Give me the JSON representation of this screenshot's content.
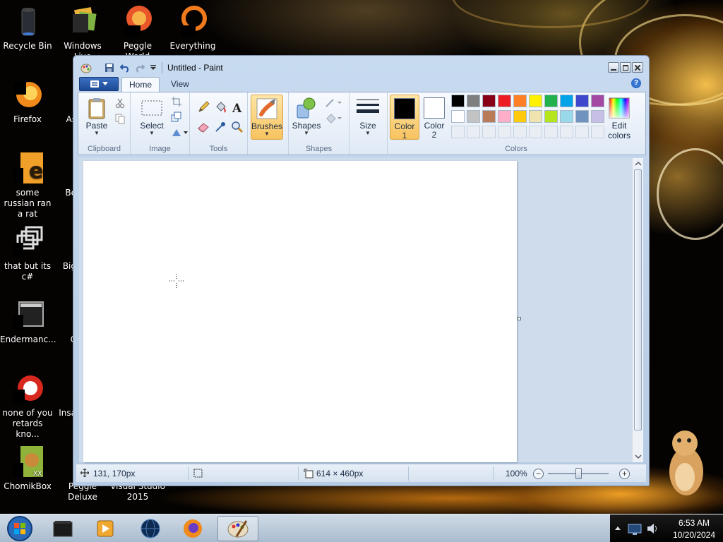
{
  "desktop": {
    "icons": [
      {
        "label": "Recycle Bin"
      },
      {
        "label": "Windows Live"
      },
      {
        "label": "Peggle World"
      },
      {
        "label": "Everything"
      },
      {
        "label": "Firefox"
      },
      {
        "label": "some russian ran a rat"
      },
      {
        "label": "that but its c#"
      },
      {
        "label": "Endermanc..."
      },
      {
        "label": "none of you retards kno..."
      },
      {
        "label": "ChomikBox"
      },
      {
        "label": "Peggle Deluxe"
      },
      {
        "label": "Visual Studio 2015"
      }
    ],
    "partial_labels": [
      "As",
      "Be",
      "Big",
      "C",
      "Insa"
    ]
  },
  "paint": {
    "title": "Untitled - Paint",
    "tabs": [
      "Home",
      "View"
    ],
    "help_icon": "?",
    "groups": {
      "clipboard": {
        "label": "Clipboard",
        "paste": "Paste"
      },
      "image": {
        "label": "Image",
        "select": "Select"
      },
      "tools": {
        "label": "Tools"
      },
      "brushes": {
        "label": "Brushes"
      },
      "shapes": {
        "label": "Shapes",
        "shapes_btn": "Shapes"
      },
      "size": {
        "label": "Size"
      },
      "colors": {
        "label": "Colors",
        "color1_line1": "Color",
        "color1_line2": "1",
        "color1_value": "#000000",
        "color2_line1": "Color",
        "color2_line2": "2",
        "color2_value": "#ffffff",
        "edit_line1": "Edit",
        "edit_line2": "colors",
        "palette_row1": [
          "#000000",
          "#7f7f7f",
          "#880015",
          "#ed1c24",
          "#ff7f27",
          "#fff200",
          "#22b14c",
          "#00a2e8",
          "#3f48cc",
          "#a349a4"
        ],
        "palette_row2": [
          "#ffffff",
          "#c3c3c3",
          "#b97a57",
          "#ffaec9",
          "#ffc90e",
          "#efe4b0",
          "#b5e61d",
          "#99d9ea",
          "#7092be",
          "#c8bfe7"
        ]
      }
    },
    "status": {
      "cursor_pos": "131, 170px",
      "canvas_size": "614 × 460px",
      "zoom": "100%",
      "zoom_level": 100
    }
  },
  "taskbar": {
    "time": "6:53 AM",
    "date": "10/20/2024"
  }
}
